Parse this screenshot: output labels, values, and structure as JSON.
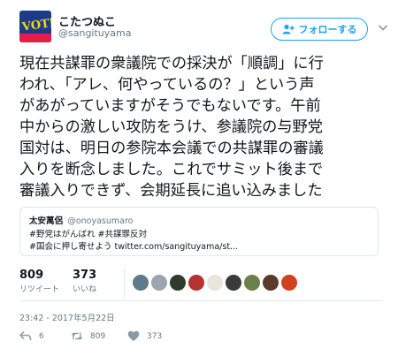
{
  "user": {
    "name": "こたつぬこ",
    "handle": "@sangituyama",
    "follow_label": "フォローする"
  },
  "tweet": {
    "lines": [
      "現在共謀罪の衆議院での採決が「順調」に行",
      "われ、「アレ、何やっているの？」という声",
      "があがっていますがそうでもないです。午前",
      "中からの激しい攻防をうけ、参議院の与野党",
      "国対は、明日の参院本会議での共謀罪の審議",
      "入りを断念しました。これでサミット後まで",
      "審議入りできず、会期延長に追い込みました"
    ]
  },
  "quote": {
    "name": "太安萬侶",
    "handle": "@onoyasumaro",
    "lines": [
      "#野党はがんばれ  #共謀罪反対",
      "#国会に押し寄せよう  twitter.com/sangituyama/st..."
    ]
  },
  "stats": {
    "retweets_count": "809",
    "retweets_label": "リツイート",
    "likes_count": "373",
    "likes_label": "いいね"
  },
  "timestamp": "23:42 - 2017年5月22日",
  "actions": {
    "reply_count": "6",
    "retweet_count": "809",
    "like_count": "373"
  },
  "colors": {
    "accent": "#1da1f2",
    "text": "#14171a",
    "muted": "#657786",
    "border": "#e1e8ed"
  }
}
